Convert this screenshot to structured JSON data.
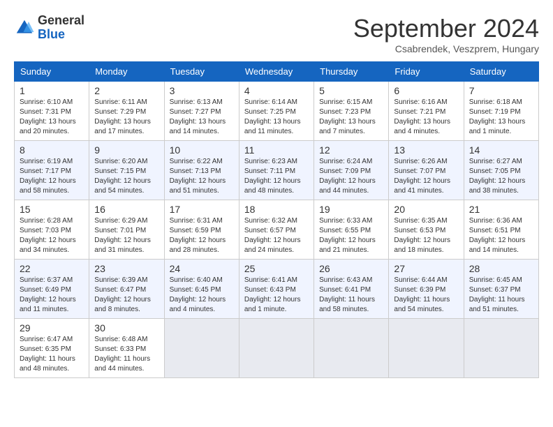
{
  "header": {
    "logo_general": "General",
    "logo_blue": "Blue",
    "month_title": "September 2024",
    "subtitle": "Csabrendek, Veszprem, Hungary"
  },
  "days_of_week": [
    "Sunday",
    "Monday",
    "Tuesday",
    "Wednesday",
    "Thursday",
    "Friday",
    "Saturday"
  ],
  "weeks": [
    [
      {
        "day": "1",
        "sunrise": "6:10 AM",
        "sunset": "7:31 PM",
        "daylight": "13 hours and 20 minutes."
      },
      {
        "day": "2",
        "sunrise": "6:11 AM",
        "sunset": "7:29 PM",
        "daylight": "13 hours and 17 minutes."
      },
      {
        "day": "3",
        "sunrise": "6:13 AM",
        "sunset": "7:27 PM",
        "daylight": "13 hours and 14 minutes."
      },
      {
        "day": "4",
        "sunrise": "6:14 AM",
        "sunset": "7:25 PM",
        "daylight": "13 hours and 11 minutes."
      },
      {
        "day": "5",
        "sunrise": "6:15 AM",
        "sunset": "7:23 PM",
        "daylight": "13 hours and 7 minutes."
      },
      {
        "day": "6",
        "sunrise": "6:16 AM",
        "sunset": "7:21 PM",
        "daylight": "13 hours and 4 minutes."
      },
      {
        "day": "7",
        "sunrise": "6:18 AM",
        "sunset": "7:19 PM",
        "daylight": "13 hours and 1 minute."
      }
    ],
    [
      {
        "day": "8",
        "sunrise": "6:19 AM",
        "sunset": "7:17 PM",
        "daylight": "12 hours and 58 minutes."
      },
      {
        "day": "9",
        "sunrise": "6:20 AM",
        "sunset": "7:15 PM",
        "daylight": "12 hours and 54 minutes."
      },
      {
        "day": "10",
        "sunrise": "6:22 AM",
        "sunset": "7:13 PM",
        "daylight": "12 hours and 51 minutes."
      },
      {
        "day": "11",
        "sunrise": "6:23 AM",
        "sunset": "7:11 PM",
        "daylight": "12 hours and 48 minutes."
      },
      {
        "day": "12",
        "sunrise": "6:24 AM",
        "sunset": "7:09 PM",
        "daylight": "12 hours and 44 minutes."
      },
      {
        "day": "13",
        "sunrise": "6:26 AM",
        "sunset": "7:07 PM",
        "daylight": "12 hours and 41 minutes."
      },
      {
        "day": "14",
        "sunrise": "6:27 AM",
        "sunset": "7:05 PM",
        "daylight": "12 hours and 38 minutes."
      }
    ],
    [
      {
        "day": "15",
        "sunrise": "6:28 AM",
        "sunset": "7:03 PM",
        "daylight": "12 hours and 34 minutes."
      },
      {
        "day": "16",
        "sunrise": "6:29 AM",
        "sunset": "7:01 PM",
        "daylight": "12 hours and 31 minutes."
      },
      {
        "day": "17",
        "sunrise": "6:31 AM",
        "sunset": "6:59 PM",
        "daylight": "12 hours and 28 minutes."
      },
      {
        "day": "18",
        "sunrise": "6:32 AM",
        "sunset": "6:57 PM",
        "daylight": "12 hours and 24 minutes."
      },
      {
        "day": "19",
        "sunrise": "6:33 AM",
        "sunset": "6:55 PM",
        "daylight": "12 hours and 21 minutes."
      },
      {
        "day": "20",
        "sunrise": "6:35 AM",
        "sunset": "6:53 PM",
        "daylight": "12 hours and 18 minutes."
      },
      {
        "day": "21",
        "sunrise": "6:36 AM",
        "sunset": "6:51 PM",
        "daylight": "12 hours and 14 minutes."
      }
    ],
    [
      {
        "day": "22",
        "sunrise": "6:37 AM",
        "sunset": "6:49 PM",
        "daylight": "12 hours and 11 minutes."
      },
      {
        "day": "23",
        "sunrise": "6:39 AM",
        "sunset": "6:47 PM",
        "daylight": "12 hours and 8 minutes."
      },
      {
        "day": "24",
        "sunrise": "6:40 AM",
        "sunset": "6:45 PM",
        "daylight": "12 hours and 4 minutes."
      },
      {
        "day": "25",
        "sunrise": "6:41 AM",
        "sunset": "6:43 PM",
        "daylight": "12 hours and 1 minute."
      },
      {
        "day": "26",
        "sunrise": "6:43 AM",
        "sunset": "6:41 PM",
        "daylight": "11 hours and 58 minutes."
      },
      {
        "day": "27",
        "sunrise": "6:44 AM",
        "sunset": "6:39 PM",
        "daylight": "11 hours and 54 minutes."
      },
      {
        "day": "28",
        "sunrise": "6:45 AM",
        "sunset": "6:37 PM",
        "daylight": "11 hours and 51 minutes."
      }
    ],
    [
      {
        "day": "29",
        "sunrise": "6:47 AM",
        "sunset": "6:35 PM",
        "daylight": "11 hours and 48 minutes."
      },
      {
        "day": "30",
        "sunrise": "6:48 AM",
        "sunset": "6:33 PM",
        "daylight": "11 hours and 44 minutes."
      },
      null,
      null,
      null,
      null,
      null
    ]
  ]
}
